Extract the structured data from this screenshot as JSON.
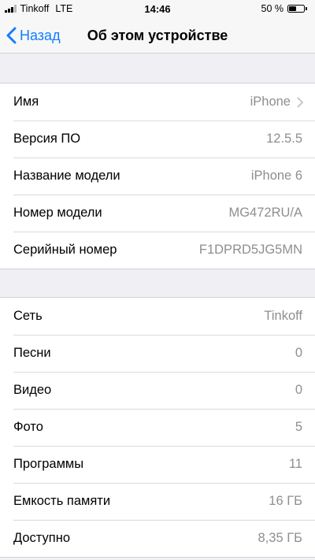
{
  "status_bar": {
    "carrier": "Tinkoff",
    "network": "LTE",
    "time": "14:46",
    "battery_percent_label": "50 %",
    "battery_level": 0.5,
    "signal_bars_filled": 3,
    "signal_bars_total": 4
  },
  "nav": {
    "back_label": "Назад",
    "title": "Об этом устройстве"
  },
  "group1": [
    {
      "label": "Имя",
      "value": "iPhone",
      "chevron": true
    },
    {
      "label": "Версия ПО",
      "value": "12.5.5"
    },
    {
      "label": "Название модели",
      "value": "iPhone 6"
    },
    {
      "label": "Номер модели",
      "value": "MG472RU/A"
    },
    {
      "label": "Серийный номер",
      "value": "F1DPRD5JG5MN"
    }
  ],
  "group2": [
    {
      "label": "Сеть",
      "value": "Tinkoff"
    },
    {
      "label": "Песни",
      "value": "0"
    },
    {
      "label": "Видео",
      "value": "0"
    },
    {
      "label": "Фото",
      "value": "5"
    },
    {
      "label": "Программы",
      "value": "11"
    },
    {
      "label": "Емкость памяти",
      "value": "16 ГБ"
    },
    {
      "label": "Доступно",
      "value": "8,35 ГБ"
    }
  ],
  "colors": {
    "accent": "#147efb",
    "secondary_text": "#8e8e93",
    "background": "#efeff4"
  },
  "icons": {
    "back": "chevron-left-icon",
    "disclosure": "chevron-right-icon"
  }
}
